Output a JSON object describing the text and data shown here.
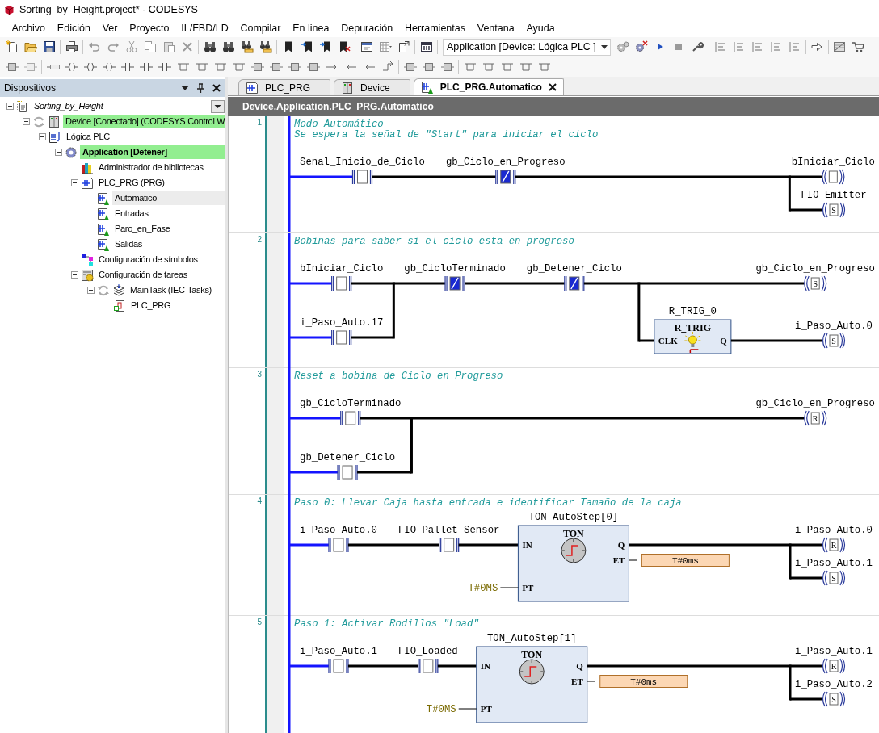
{
  "window": {
    "title": "Sorting_by_Height.project* - CODESYS"
  },
  "menu": [
    "Archivo",
    "Edición",
    "Ver",
    "Proyecto",
    "IL/FBD/LD",
    "Compilar",
    "En linea",
    "Depuración",
    "Herramientas",
    "Ventana",
    "Ayuda"
  ],
  "toolbar": {
    "application_selector": "Application [Device: Lógica PLC ]"
  },
  "devices_panel": {
    "title": "Dispositivos",
    "tree": [
      {
        "label": "Sorting_by_Height",
        "kind": "project",
        "expanded": true,
        "selected": false,
        "children": [
          {
            "label": "Device [Conectado] (CODESYS Control W",
            "kind": "device",
            "online": true,
            "expanded": true,
            "selected": false,
            "children": [
              {
                "label": "Lógica PLC",
                "kind": "plc-logic",
                "expanded": true,
                "selected": false,
                "children": [
                  {
                    "label": "Application [Detener]",
                    "kind": "application",
                    "online": true,
                    "active": true,
                    "expanded": true,
                    "selected": false,
                    "children": [
                      {
                        "label": "Administrador de bibliotecas",
                        "kind": "library",
                        "selected": false
                      },
                      {
                        "label": "PLC_PRG (PRG)",
                        "kind": "pou",
                        "expanded": true,
                        "selected": false,
                        "children": [
                          {
                            "label": "Automatico",
                            "kind": "action",
                            "selected": true
                          },
                          {
                            "label": "Entradas",
                            "kind": "action",
                            "selected": false
                          },
                          {
                            "label": "Paro_en_Fase",
                            "kind": "action",
                            "selected": false
                          },
                          {
                            "label": "Salidas",
                            "kind": "action",
                            "selected": false
                          }
                        ]
                      },
                      {
                        "label": "Configuración de símbolos",
                        "kind": "symbols",
                        "selected": false
                      },
                      {
                        "label": "Configuración de tareas",
                        "kind": "tasks",
                        "expanded": true,
                        "selected": false,
                        "children": [
                          {
                            "label": "MainTask (IEC-Tasks)",
                            "kind": "task",
                            "expanded": true,
                            "selected": false,
                            "children": [
                              {
                                "label": "PLC_PRG",
                                "kind": "call",
                                "selected": false
                              }
                            ]
                          }
                        ]
                      }
                    ]
                  }
                ]
              }
            ]
          }
        ]
      }
    ]
  },
  "editor": {
    "tabs": [
      {
        "label": "PLC_PRG",
        "kind": "pou",
        "selected": false
      },
      {
        "label": "Device",
        "kind": "device",
        "selected": false
      },
      {
        "label": "PLC_PRG.Automatico",
        "kind": "action",
        "selected": true
      }
    ],
    "path": "Device.Application.PLC_PRG.Automatico",
    "networks": [
      {
        "number": "1",
        "comment": [
          "Modo Automático",
          "Se espera la señal de \"Start\" para iniciar el ciclo"
        ],
        "branches": [
          [
            {
              "name": "Senal_Inicio_de_Ciclo",
              "negated": false
            }
          ]
        ],
        "series": [
          {
            "name": "gb_Ciclo_en_Progreso",
            "negated": true
          }
        ],
        "outputs": [
          {
            "coil": {
              "name": "bIniciar_Ciclo"
            }
          },
          {
            "coil": {
              "name": "FIO_Emitter",
              "letter": "S"
            }
          }
        ]
      },
      {
        "number": "2",
        "comment": [
          "Bobinas para saber si el ciclo esta en progreso"
        ],
        "branches": [
          [
            {
              "name": "bIniciar_Ciclo",
              "negated": false
            }
          ],
          [
            {
              "name": "i_Paso_Auto.17",
              "negated": false
            }
          ]
        ],
        "series": [
          {
            "name": "gb_CicloTerminado",
            "negated": true
          },
          {
            "name": "gb_Detener_Ciclo",
            "negated": true
          }
        ],
        "outputs": [
          {
            "coil": {
              "name": "gb_Ciclo_en_Progreso",
              "letter": "S"
            }
          },
          {
            "block": {
              "kind": "trigger",
              "instance": "R_TRIG_0",
              "type": "R_TRIG",
              "inputs": [
                {
                  "pin": "CLK"
                }
              ],
              "outputs": [
                {
                  "pin": "Q"
                }
              ]
            },
            "coil": {
              "name": "i_Paso_Auto.0",
              "letter": "S"
            }
          }
        ]
      },
      {
        "number": "3",
        "comment": [
          "Reset a bobina de Ciclo en Progreso"
        ],
        "branches": [
          [
            {
              "name": "gb_CicloTerminado",
              "negated": false
            }
          ],
          [
            {
              "name": "gb_Detener_Ciclo",
              "negated": false
            }
          ]
        ],
        "outputs": [
          {
            "coil": {
              "name": "gb_Ciclo_en_Progreso",
              "letter": "R"
            }
          }
        ]
      },
      {
        "number": "4",
        "comment": [
          "Paso 0: Llevar Caja hasta entrada e identificar Tamaño de la caja"
        ],
        "branches": [
          [
            {
              "name": "i_Paso_Auto.0",
              "negated": false
            }
          ]
        ],
        "series": [
          {
            "name": "FIO_Pallet_Sensor",
            "negated": false
          }
        ],
        "block": {
          "kind": "timer",
          "instance": "TON_AutoStep[0]",
          "type": "TON",
          "inputs": [
            {
              "pin": "IN"
            },
            {
              "pin": "PT",
              "value": "T#0MS"
            }
          ],
          "outputs": [
            {
              "pin": "Q"
            },
            {
              "pin": "ET",
              "value": "T#0ms"
            }
          ]
        },
        "outputs": [
          {
            "coil": {
              "name": "i_Paso_Auto.0",
              "letter": "R"
            }
          },
          {
            "coil": {
              "name": "i_Paso_Auto.1",
              "letter": "S"
            }
          }
        ]
      },
      {
        "number": "5",
        "comment": [
          "Paso 1: Activar Rodillos \"Load\""
        ],
        "branches": [
          [
            {
              "name": "i_Paso_Auto.1",
              "negated": false
            }
          ]
        ],
        "series": [
          {
            "name": "FIO_Loaded",
            "negated": false
          }
        ],
        "block": {
          "kind": "timer",
          "instance": "TON_AutoStep[1]",
          "type": "TON",
          "inputs": [
            {
              "pin": "IN"
            },
            {
              "pin": "PT",
              "value": "T#0MS"
            }
          ],
          "outputs": [
            {
              "pin": "Q"
            },
            {
              "pin": "ET",
              "value": "T#0ms"
            }
          ]
        },
        "outputs": [
          {
            "coil": {
              "name": "i_Paso_Auto.1",
              "letter": "R"
            }
          },
          {
            "coil": {
              "name": "i_Paso_Auto.2",
              "letter": "S"
            }
          }
        ]
      }
    ]
  }
}
